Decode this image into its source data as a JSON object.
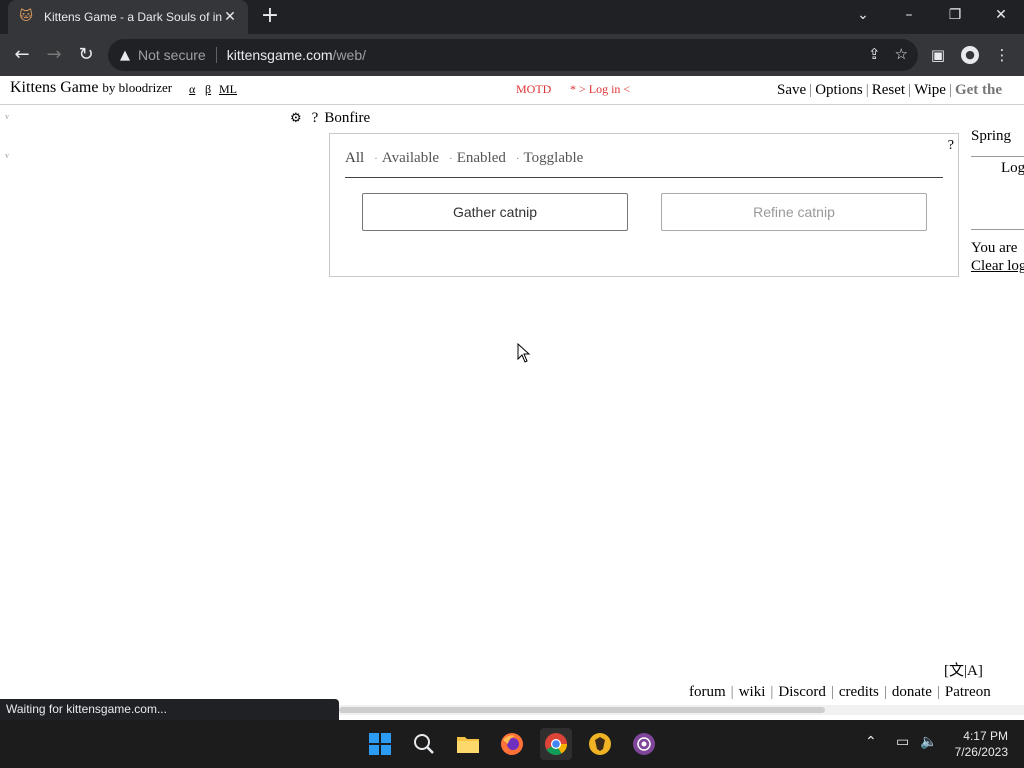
{
  "browser": {
    "tab_title": "Kittens Game - a Dark Souls of in",
    "not_secure": "Not secure",
    "url_host": "kittensgame.com",
    "url_path": "/web/",
    "status_text": "Waiting for kittensgame.com..."
  },
  "header": {
    "title": "Kittens Game",
    "by": "by bloodrizer",
    "links": [
      "α",
      "β",
      "ML"
    ],
    "motd": "MOTD",
    "login": "* > Log in <",
    "actions": [
      "Save",
      "Options",
      "Reset",
      "Wipe",
      "Get the"
    ]
  },
  "side_marks": [
    "v",
    "v"
  ],
  "bonfire": {
    "help": "?",
    "title": "Bonfire",
    "panel_help": "?",
    "filters": [
      "All",
      "Available",
      "Enabled",
      "Togglable"
    ],
    "buttons": [
      "Gather catnip",
      "Refine catnip"
    ]
  },
  "right_column": {
    "season": "Spring",
    "log_tab": "Log",
    "message": "You are",
    "clear_log": "Clear log"
  },
  "footer": {
    "language_toggle": "[文|A]",
    "links": [
      "forum",
      "wiki",
      "Discord",
      "credits",
      "donate",
      "Patreon"
    ]
  },
  "taskbar": {
    "time": "4:17 PM",
    "date": "7/26/2023"
  },
  "colors": {
    "chrome_dark": "#202124",
    "chrome_toolbar": "#35363a",
    "motd_red": "#dd3333",
    "taskbar": "#1c1c1c"
  }
}
